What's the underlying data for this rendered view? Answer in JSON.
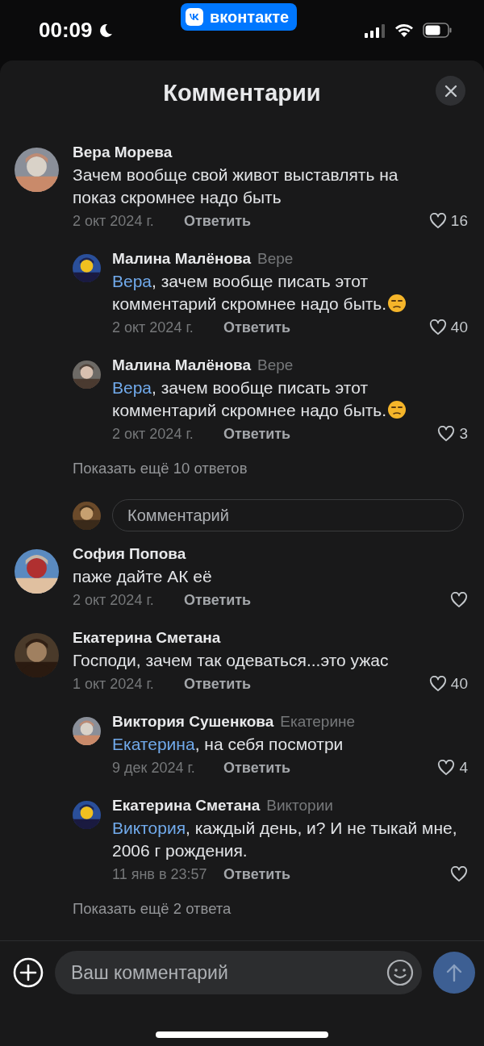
{
  "status_bar": {
    "time": "00:09",
    "app_badge": "вконтакте"
  },
  "header": {
    "title": "Комментарии"
  },
  "threads": [
    {
      "comment": {
        "author": "Вера Морева",
        "text": "Зачем вообще свой живот выставлять на показ скромнее надо быть",
        "date": "2 окт 2024 г.",
        "reply_label": "Ответить",
        "likes": "16"
      },
      "replies": [
        {
          "author": "Малина Малёнова",
          "reply_to": "Вере",
          "mention": "Вера",
          "text": ", зачем вообще писать этот комментарий скромнее надо быть.",
          "emoji": true,
          "date": "2 окт 2024 г.",
          "reply_label": "Ответить",
          "likes": "40"
        },
        {
          "author": "Малина Малёнова",
          "reply_to": "Вере",
          "mention": "Вера",
          "text": ", зачем вообще писать этот комментарий скромнее надо быть.",
          "emoji": true,
          "date": "2 окт 2024 г.",
          "reply_label": "Ответить",
          "likes": "3"
        }
      ],
      "more": "Показать ещё 10 ответов",
      "input_placeholder": "Комментарий"
    },
    {
      "comment": {
        "author": "София Попова",
        "text": "паже дайте АК её",
        "date": "2 окт 2024 г.",
        "reply_label": "Ответить"
      }
    },
    {
      "comment": {
        "author": "Екатерина Сметана",
        "text": "Господи, зачем так одеваться...это ужас",
        "date": "1 окт 2024 г.",
        "reply_label": "Ответить",
        "likes": "40"
      },
      "replies": [
        {
          "author": "Виктория Сушенкова",
          "reply_to": "Екатерине",
          "mention": "Екатерина",
          "text": ", на себя посмотри",
          "date": "9 дек 2024 г.",
          "reply_label": "Ответить",
          "likes": "4"
        },
        {
          "author": "Екатерина Сметана",
          "reply_to": "Виктории",
          "mention": "Виктория",
          "text": ", каждый день, и? И не тыкай мне, 2006 г рождения.",
          "date": "11 янв в 23:57",
          "reply_label": "Ответить"
        }
      ],
      "more": "Показать ещё 2 ответа"
    }
  ],
  "composer": {
    "placeholder": "Ваш комментарий"
  }
}
